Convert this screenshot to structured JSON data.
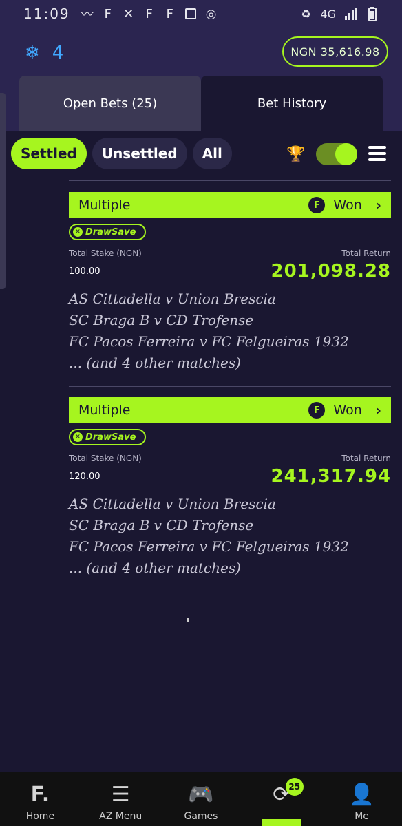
{
  "status_bar": {
    "time": "11:09",
    "icons_left": [
      "activity-icon",
      "f-app-icon",
      "x-icon",
      "f-app-icon",
      "f-app-icon",
      "image-icon",
      "whatsapp-icon"
    ],
    "icons_right": [
      "battery-saver-icon",
      "4g-icon",
      "signal-icon",
      "battery-icon"
    ],
    "network": "4G"
  },
  "header": {
    "freeze_count": "4",
    "freeze_icon": "snowflake-icon",
    "balance": "NGN 35,616.98"
  },
  "tabs": [
    {
      "label": "Open Bets (25)",
      "active": false
    },
    {
      "label": "Bet History",
      "active": true
    }
  ],
  "filters": {
    "settled": "Settled",
    "unsettled": "Unsettled",
    "all": "All",
    "active": "Settled"
  },
  "toolbar": {
    "trophy_icon": "trophy-icon",
    "toggle_on": true,
    "menu_icon": "hamburger-icon"
  },
  "bets": [
    {
      "type": "Multiple",
      "status": "Won",
      "badge": "DrawSave",
      "stake_label": "Total Stake (NGN)",
      "stake": "100.00",
      "return_label": "Total Return",
      "return": "201,098.28",
      "matches": [
        "AS Cittadella v Union Brescia",
        "SC Braga B v CD Trofense",
        "FC Pacos Ferreira v FC Felgueiras 1932",
        "... (and 4 other matches)"
      ]
    },
    {
      "type": "Multiple",
      "status": "Won",
      "badge": "DrawSave",
      "stake_label": "Total Stake (NGN)",
      "stake": "120.00",
      "return_label": "Total Return",
      "return": "241,317.94",
      "matches": [
        "AS Cittadella v Union Brescia",
        "SC Braga B v CD Trofense",
        "FC Pacos Ferreira v FC Felgueiras 1932",
        "... (and 4 other matches)"
      ]
    }
  ],
  "bottom_nav": [
    {
      "label": "Home",
      "icon": "f-logo-icon"
    },
    {
      "label": "AZ Menu",
      "icon": "hamburger-icon"
    },
    {
      "label": "Games",
      "icon": "gamepad-icon"
    },
    {
      "label": "",
      "icon": "cashout-icon",
      "badge": "25",
      "active": true
    },
    {
      "label": "Me",
      "icon": "person-icon"
    }
  ],
  "colors": {
    "accent": "#a6f51f",
    "background": "#1a1731",
    "header": "#2b2550",
    "freeze": "#41a8ff"
  }
}
